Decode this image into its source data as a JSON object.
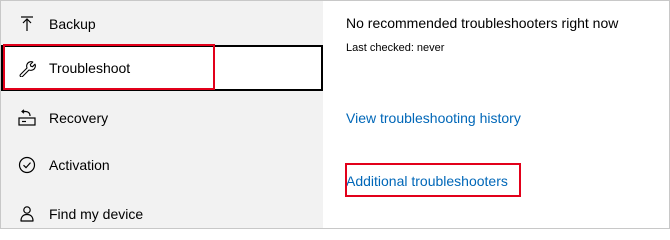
{
  "sidebar": {
    "items": [
      {
        "label": "Backup",
        "icon": "backup-arrow-icon",
        "selected": false
      },
      {
        "label": "Troubleshoot",
        "icon": "wrench-icon",
        "selected": true
      },
      {
        "label": "Recovery",
        "icon": "recovery-icon",
        "selected": false
      },
      {
        "label": "Activation",
        "icon": "checkmark-circle-icon",
        "selected": false
      },
      {
        "label": "Find my device",
        "icon": "person-locate-icon",
        "selected": false
      }
    ]
  },
  "content": {
    "status_title": "No recommended troubleshooters right now",
    "last_checked": "Last checked: never",
    "history_link": "View troubleshooting history",
    "additional_link": "Additional troubleshooters"
  },
  "colors": {
    "sidebar_bg": "#f2f2f2",
    "link": "#0067b8",
    "highlight": "#e2001a",
    "selected_border": "#000000"
  }
}
